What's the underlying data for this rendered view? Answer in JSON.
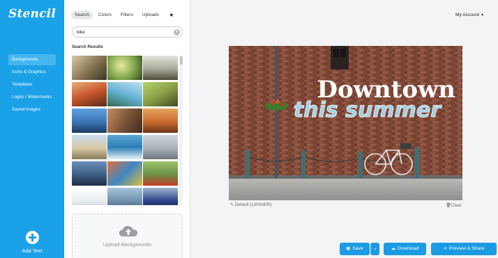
{
  "app": {
    "logo": "Stencil"
  },
  "sidebar": {
    "items": [
      {
        "label": "Backgrounds",
        "active": true
      },
      {
        "label": "Icons & Graphics",
        "active": false
      },
      {
        "label": "Templates",
        "active": false
      },
      {
        "label": "Logos / Watermarks",
        "active": false
      },
      {
        "label": "Saved Images",
        "active": false
      }
    ],
    "add_text_label": "Add Text"
  },
  "panel": {
    "tabs": [
      {
        "label": "Search",
        "active": true
      },
      {
        "label": "Colors",
        "active": false
      },
      {
        "label": "Filters",
        "active": false
      },
      {
        "label": "Uploads",
        "active": false
      }
    ],
    "favorites_icon": "star-icon",
    "search": {
      "value": "bike",
      "placeholder": ""
    },
    "results_label": "Search Results",
    "upload_label": "Upload Backgrounds"
  },
  "header": {
    "account_label": "My Account"
  },
  "canvas": {
    "headline": "Downtown",
    "subline": "this summer",
    "size_label": "Default (1200x800)",
    "clear_label": "Clear"
  },
  "actions": {
    "save": "Save",
    "download": "Download",
    "share": "Preview & Share"
  },
  "colors": {
    "brand": "#1ba1e8",
    "button": "#1b9be3",
    "headline_text": "#ffffff",
    "subline_text": "#9fd0e6"
  }
}
